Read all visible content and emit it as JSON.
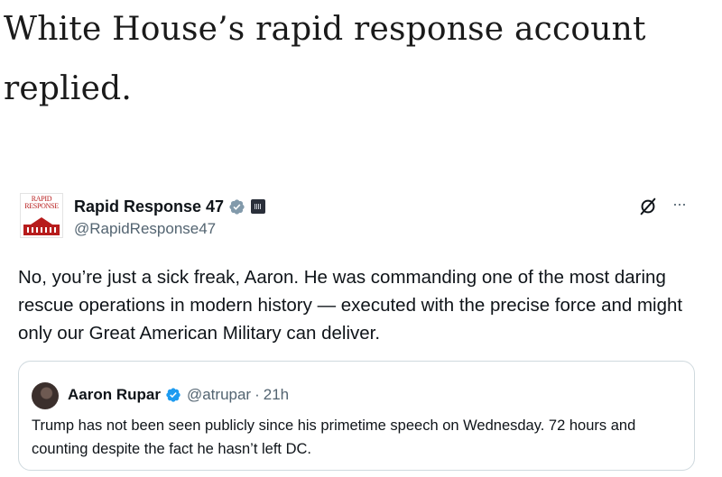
{
  "headline": "White House’s rapid response account replied.",
  "tweet": {
    "avatar_text": "RAPID RESPONSE",
    "display_name": "Rapid Response 47",
    "handle": "@RapidResponse47",
    "body": "No, you’re just a sick freak, Aaron. He was commanding one of the most daring rescue operations in modern history — executed with the precise force and might only our Great American Military can deliver.",
    "more_label": "···"
  },
  "quote": {
    "display_name": "Aaron Rupar",
    "handle": "@atrupar",
    "separator": "·",
    "time": "21h",
    "body": "Trump has not been seen publicly since his primetime speech on Wednesday. 72 hours and counting despite the fact he hasn’t left DC."
  },
  "colors": {
    "verified_blue": "#1d9bf0",
    "text_primary": "#0f1419",
    "text_secondary": "#536471",
    "avatar_red": "#b71c1c",
    "border": "#cfd9de"
  }
}
